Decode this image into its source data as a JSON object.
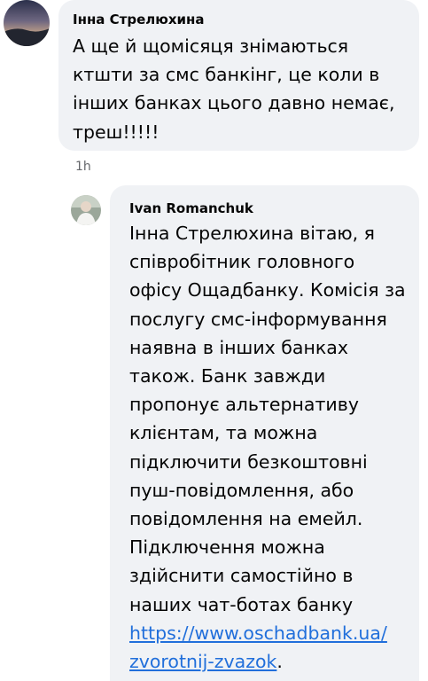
{
  "comments": [
    {
      "author": "Інна Стрелюхина",
      "lines": [
        "А ще й щомісяця знімаються",
        "ктшти за смс банкінг, це коли в",
        "інших банках цього давно немає,",
        "треш!!!!!"
      ],
      "time": "1h"
    },
    {
      "author": "Ivan Romanchuk",
      "lines": [
        "Інна Стрелюхина вітаю, я",
        "співробітник головного",
        "офісу Ощадбанку. Комісія за",
        "послугу смс-інформування",
        "наявна в інших банках",
        "також. Банк завжди",
        "пропонує альтернативу",
        "клієнтам, та можна",
        "підключити безкоштовні",
        "пуш-повідомлення, або",
        "повідомлення на емейл.",
        "Підключення можна",
        "здійснити самостійно в",
        "наших чат-ботах банку"
      ],
      "link_lines": [
        "https://www.oschadbank.ua/",
        "zvorotnij-zvazok"
      ],
      "after_link": "."
    }
  ]
}
